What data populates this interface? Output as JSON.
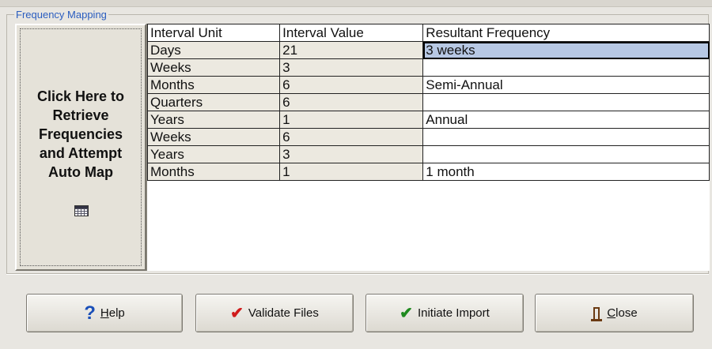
{
  "group": {
    "title": "Frequency Mapping"
  },
  "left_button": {
    "label": "Click Here to\nRetrieve\nFrequencies\nand Attempt\nAuto Map",
    "icon": "calendar-icon"
  },
  "grid": {
    "headers": [
      "Interval Unit",
      "Interval Value",
      "Resultant Frequency"
    ],
    "rows": [
      {
        "unit": "Days",
        "value": "21",
        "freq": "3 weeks"
      },
      {
        "unit": "Weeks",
        "value": "3",
        "freq": ""
      },
      {
        "unit": "Months",
        "value": "6",
        "freq": "Semi-Annual"
      },
      {
        "unit": "Quarters",
        "value": "6",
        "freq": ""
      },
      {
        "unit": "Years",
        "value": "1",
        "freq": "Annual"
      },
      {
        "unit": "Weeks",
        "value": "6",
        "freq": ""
      },
      {
        "unit": "Years",
        "value": "3",
        "freq": ""
      },
      {
        "unit": "Months",
        "value": "1",
        "freq": "1 month"
      }
    ]
  },
  "buttons": {
    "help": {
      "mnemonic": "H",
      "rest": "elp",
      "icon": "help-icon"
    },
    "validate": {
      "label": "Validate Files",
      "icon": "red-check-icon"
    },
    "import": {
      "label": "Initiate Import",
      "icon": "green-check-icon"
    },
    "close": {
      "mnemonic": "C",
      "rest": "lose",
      "icon": "door-exit-icon"
    }
  },
  "colors": {
    "selected_cell": "#b7c8e4",
    "legend": "#2a5dbf",
    "help_icon": "#1a4fb8",
    "validate_check": "#d01b1b",
    "import_check": "#1f8a1f"
  }
}
